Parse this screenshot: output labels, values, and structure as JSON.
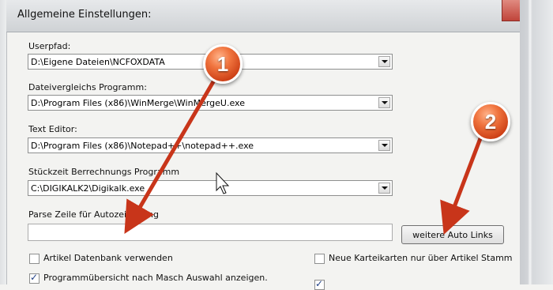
{
  "window": {
    "title": "Allgemeine Einstellungen:"
  },
  "fields": [
    {
      "label": "Userpfad:",
      "value": "D:\\Eigene Dateien\\NCFOXDATA"
    },
    {
      "label": "Dateivergleichs Programm:",
      "value": "D:\\Program Files (x86)\\WinMerge\\WinMergeU.exe"
    },
    {
      "label": "Text Editor:",
      "value": "D:\\Program Files (x86)\\Notepad++\\notepad++.exe"
    },
    {
      "label": "Stückzeit Berrechnungs Programm",
      "value": "C:\\DIGIKALK2\\Digikalk.exe"
    }
  ],
  "parse": {
    "label": "Parse Zeile für Autozeichnung",
    "value": ""
  },
  "auto_links_button": "weitere Auto Links",
  "checkboxes": [
    {
      "label": "Artikel Datenbank verwenden",
      "checked": false
    },
    {
      "label": "Neue Karteikarten nur über Artikel Stamm",
      "checked": false
    },
    {
      "label": "Programmübersicht nach Masch Auswahl anzeigen.",
      "checked": true
    },
    {
      "label": "",
      "checked": true
    }
  ],
  "markers": [
    "1",
    "2"
  ],
  "colors": {
    "marker": "#e5552a",
    "arrow": "#c8351a"
  }
}
